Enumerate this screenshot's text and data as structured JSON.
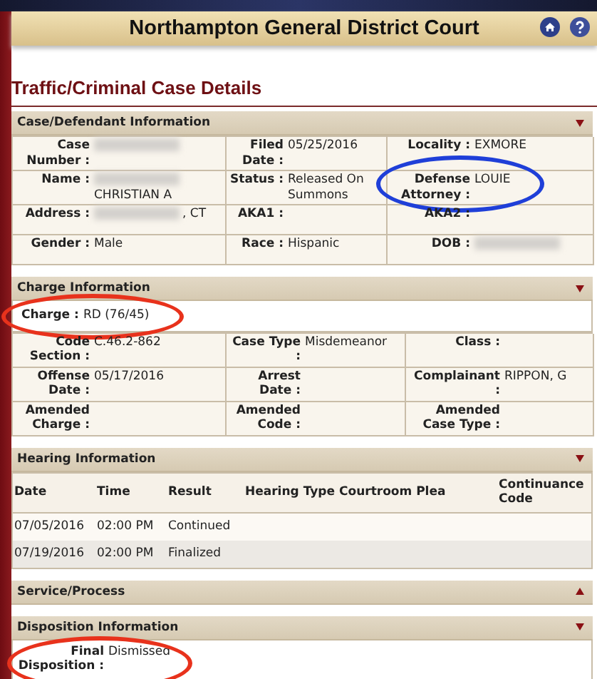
{
  "court_title": "Northampton General District Court",
  "page_title": "Traffic/Criminal Case Details",
  "sections": [
    {
      "title": "Case/Defendant Information",
      "expanded": true,
      "kind": "fields",
      "rows": [
        [
          {
            "label": "Case Number :",
            "redacted": true
          },
          {
            "label": "Filed Date :",
            "value": "05/25/2016"
          },
          {
            "label": "Locality :",
            "value": "EXMORE"
          }
        ],
        [
          {
            "label": "Name :",
            "value": "CHRISTIAN A",
            "redacted": true
          },
          {
            "label": "Status :",
            "value": "Released On Summons"
          },
          {
            "label": "Defense Attorney :",
            "value": "LOUIE",
            "color": "#1f3fd8"
          }
        ],
        [
          {
            "label": "Address :",
            "value": ", CT",
            "redacted": true
          },
          {
            "label": "AKA1 :"
          },
          {
            "label": "AKA2 :"
          }
        ],
        [
          {
            "label": "Gender :",
            "value": "Male"
          },
          {
            "label": "Race :",
            "value": "Hispanic"
          },
          {
            "label": "DOB :",
            "redacted": true
          }
        ]
      ]
    },
    {
      "title": "Charge Information",
      "expanded": true,
      "kind": "charge",
      "charge": {
        "label": "Charge :",
        "value": "RD (76/45)",
        "color": "#e8321c"
      },
      "rows": [
        [
          {
            "label": "Code Section :",
            "value": "C.46.2-862"
          },
          {
            "label": "Case Type :",
            "value": "Misdemeanor"
          },
          {
            "label": "Class :"
          }
        ],
        [
          {
            "label": "Offense Date :",
            "value": "05/17/2016"
          },
          {
            "label": "Arrest Date :"
          },
          {
            "label": "Complainant :",
            "value": "RIPPON, G"
          }
        ],
        [
          {
            "label": "Amended Charge :"
          },
          {
            "label": "Amended Code :"
          },
          {
            "label": "Amended Case Type :"
          }
        ]
      ]
    },
    {
      "title": "Hearing Information",
      "expanded": true,
      "kind": "table",
      "columns": [
        "Date",
        "Time",
        "Result",
        "Hearing Type",
        "Courtroom Plea",
        "Continuance Code"
      ],
      "rows": [
        [
          "07/05/2016",
          "02:00 PM",
          "Continued",
          "",
          "",
          ""
        ],
        [
          "07/19/2016",
          "02:00 PM",
          "Finalized",
          "",
          "",
          ""
        ]
      ]
    },
    {
      "title": "Service/Process",
      "expanded": false
    },
    {
      "title": "Disposition Information",
      "expanded": true,
      "kind": "single",
      "charge": {
        "label": "Final Disposition :",
        "value": "Dismissed",
        "color": "#e8321c"
      }
    }
  ]
}
